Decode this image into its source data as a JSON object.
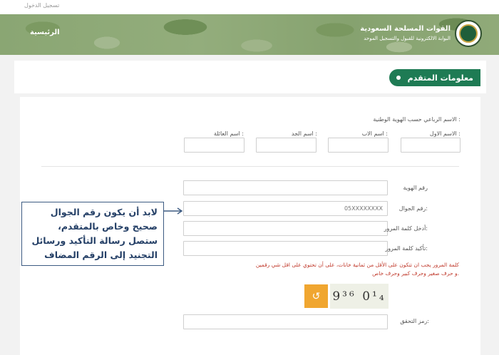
{
  "topbar": {
    "login_link": "تسجيل الدخول"
  },
  "header": {
    "title": "القوات المسلحة السعودية",
    "subtitle": "البوابة الالكترونية للقبول والتسجيل الموحد",
    "home_link": "الرئيسية"
  },
  "section": {
    "title": "معلومات المتقدم"
  },
  "form": {
    "name_section_label": "الاسم الرباعي حسب الهوية الوطنية :",
    "first_name_label": "الاسم الاول :",
    "father_name_label": "اسم الاب :",
    "grandfather_name_label": "اسم الجد :",
    "family_name_label": "اسم العائلة :",
    "id_label": "رقم الهوية",
    "mobile_label": "رقم الجوال:",
    "mobile_placeholder": "05XXXXXXXX",
    "password_label": "أدخل كلمة المرور:",
    "confirm_password_label": "تأكيد كلمة المرور:",
    "password_hint_1": "كلمة المرور يجب ان تتكون على الأقل من ثمانية خانات، على أن تحتوي على اقل شي رقمين",
    "password_hint_2": "و حرف صغير وحرف كبير وحرف خاص.",
    "captcha_text": "9³⁶ 0¹₄",
    "refresh_icon": "refresh-icon",
    "verification_label": "رمز التحقق:"
  },
  "annotation": {
    "line1": "لابد أن يكون رقم الجوال",
    "line2": "صحيح وخاص بالمتقدم،",
    "line3": "ستصل رسالة التأكيد ورسائل",
    "line4": "التجنيد إلى الرقم المضاف"
  },
  "colors": {
    "accent": "#1e7b54",
    "annotation_border": "#3d5b82",
    "hint": "#c0392b",
    "refresh": "#f0a630"
  }
}
